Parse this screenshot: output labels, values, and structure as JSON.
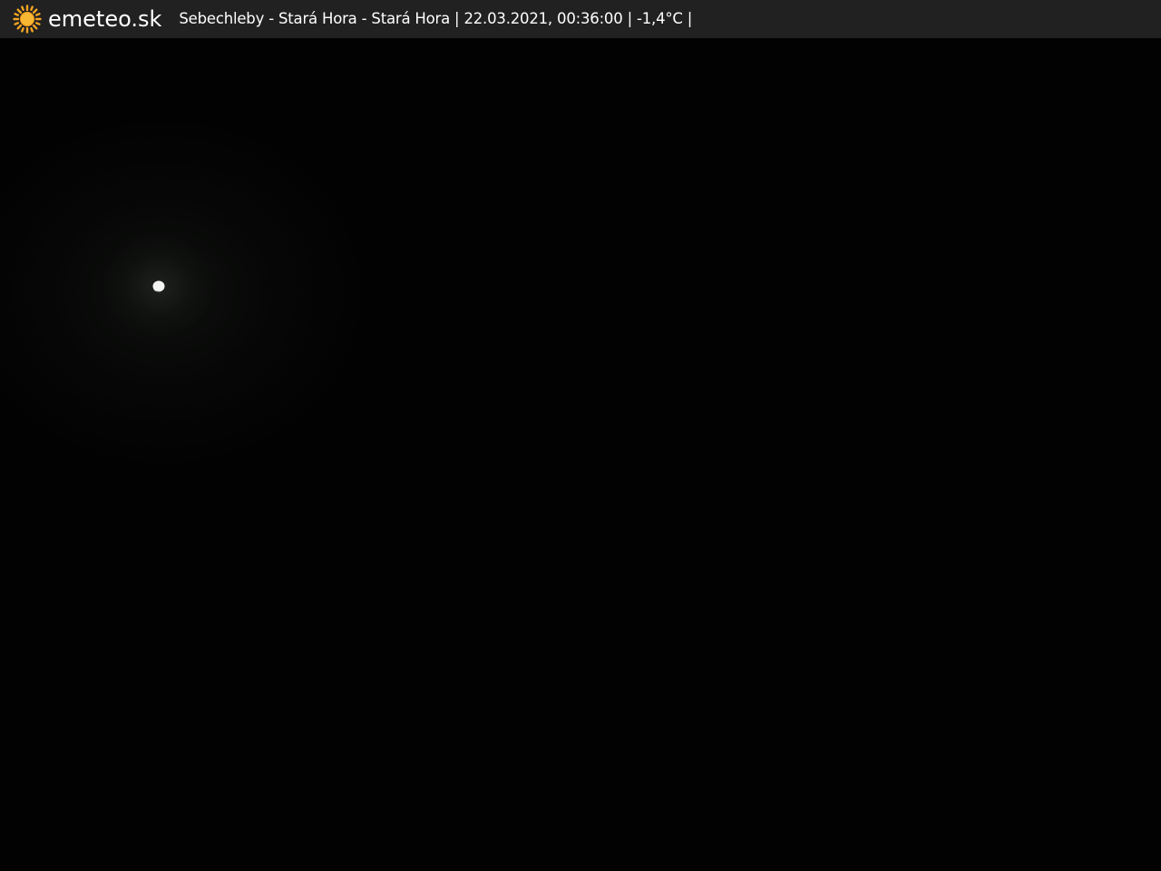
{
  "header": {
    "brand": "emeteo.sk",
    "caption": "Sebechleby - Stará Hora - Stará Hora | 22.03.2021, 00:36:00 | -1,4°C |",
    "logo_icon": "sun-icon",
    "logo_color": "#f5a623",
    "bar_color": "#212121"
  },
  "scene": {
    "background_color": "#020202",
    "subject": "moon-icon"
  }
}
